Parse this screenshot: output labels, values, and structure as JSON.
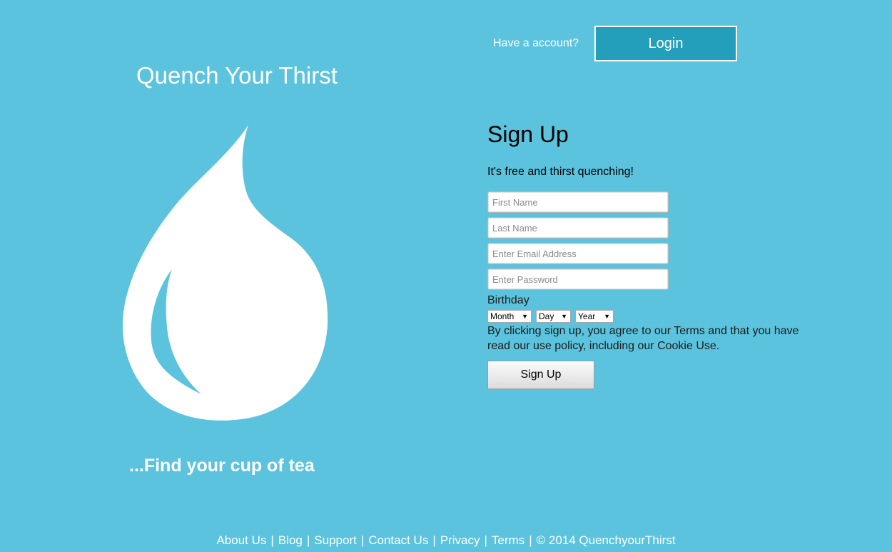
{
  "header": {
    "have_account_text": "Have a account?",
    "login_label": "Login"
  },
  "brand": {
    "title": "Quench Your Thirst",
    "tagline": "...Find your cup of tea",
    "logo_icon": "water-drop-icon"
  },
  "signup": {
    "heading": "Sign Up",
    "subheading": "It's free and thirst quenching!",
    "fields": {
      "first_name": {
        "placeholder": "First Name",
        "value": ""
      },
      "last_name": {
        "placeholder": "Last Name",
        "value": ""
      },
      "email": {
        "placeholder": "Enter Email Address",
        "value": ""
      },
      "password": {
        "placeholder": "Enter Password",
        "value": ""
      }
    },
    "birthday_label": "Birthday",
    "birthday": {
      "month": "Month",
      "day": "Day",
      "year": "Year"
    },
    "terms_text": "By clicking sign up, you agree to our Terms and that you have read our use policy, including our Cookie Use.",
    "submit_label": "Sign Up"
  },
  "footer": {
    "links": [
      "About Us",
      "Blog",
      "Support",
      "Contact Us",
      "Privacy",
      "Terms"
    ],
    "copyright": "© 2014 QuenchyourThirst",
    "separator": "|"
  },
  "colors": {
    "background": "#5bc3dd",
    "login_button": "#249fbb",
    "text_light": "#ffffff",
    "text_dark": "#000000"
  }
}
